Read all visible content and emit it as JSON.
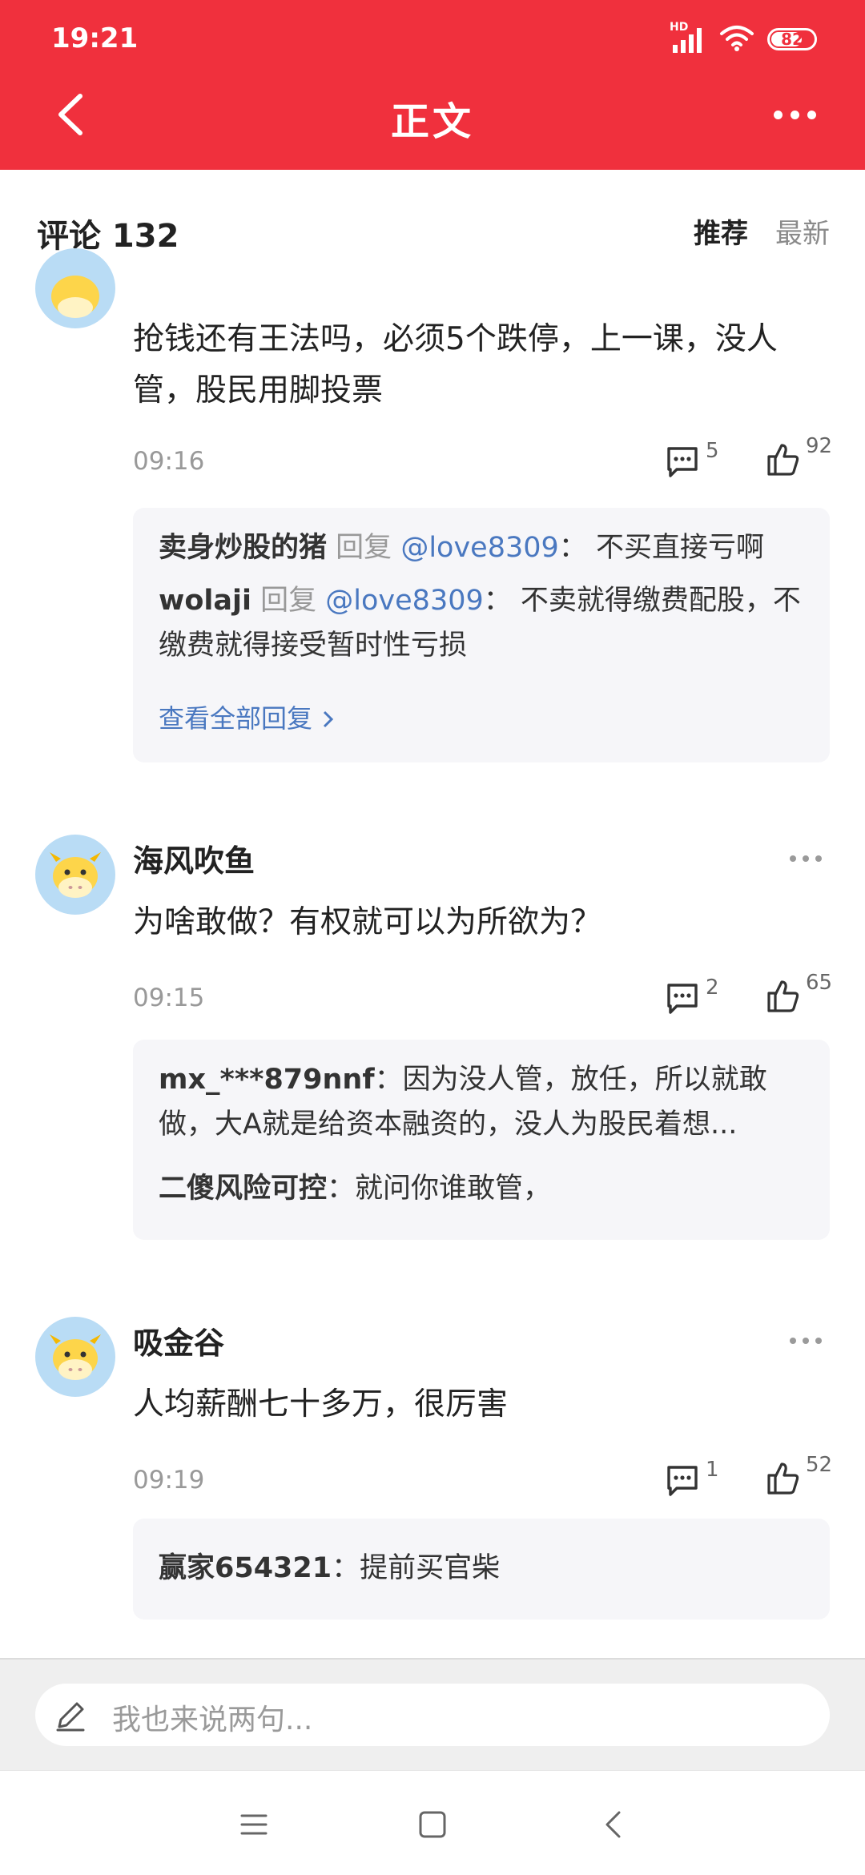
{
  "status": {
    "time": "19:21",
    "network": "HD",
    "battery": "82"
  },
  "nav": {
    "title": "正文"
  },
  "comments_header": {
    "label": "评论 132",
    "sort_recommended": "推荐",
    "sort_latest": "最新"
  },
  "comments": [
    {
      "content": "抢钱还有王法吗，必须5个跌停，上一课，没人管，股民用脚投票",
      "time": "09:16",
      "reply_count": "5",
      "like_count": "92",
      "replies": [
        {
          "user": "卖身炒股的猪",
          "reply_word": "回复",
          "mention": "@love8309",
          "sep": "：",
          "text": "不买直接亏啊"
        },
        {
          "user": "wolaji",
          "reply_word": "回复",
          "mention": "@love8309",
          "sep": "：",
          "text": "不卖就得缴费配股，不缴费就得接受暂时性亏损"
        }
      ],
      "view_all": "查看全部回复"
    },
    {
      "author": "海风吹鱼",
      "content": "为啥敢做？有权就可以为所欲为？",
      "time": "09:15",
      "reply_count": "2",
      "like_count": "65",
      "replies": [
        {
          "user": "mx_***879nnf",
          "sep": "：",
          "text": "因为没人管，放任，所以就敢做，大A就是给资本融资的，没人为股民着想..."
        },
        {
          "user": "二傻风险可控",
          "sep": "：",
          "text": "就问你谁敢管，"
        }
      ]
    },
    {
      "author": "吸金谷",
      "content": "人均薪酬七十多万，很厉害",
      "time": "09:19",
      "reply_count": "1",
      "like_count": "52",
      "replies": [
        {
          "user": "赢家654321",
          "sep": "：",
          "text": "提前买官柴"
        }
      ]
    }
  ],
  "input": {
    "placeholder": "我也来说两句..."
  },
  "icons": {
    "back": "chevron-left-icon",
    "more": "more-horizontal-icon",
    "comment": "comment-bubble-icon",
    "like": "thumbs-up-icon",
    "pen": "pen-icon",
    "avatar": "cow-avatar-icon"
  },
  "colors": {
    "brand": "#f0303d",
    "link": "#4a78c0",
    "reply_bg": "#f6f6f9"
  }
}
